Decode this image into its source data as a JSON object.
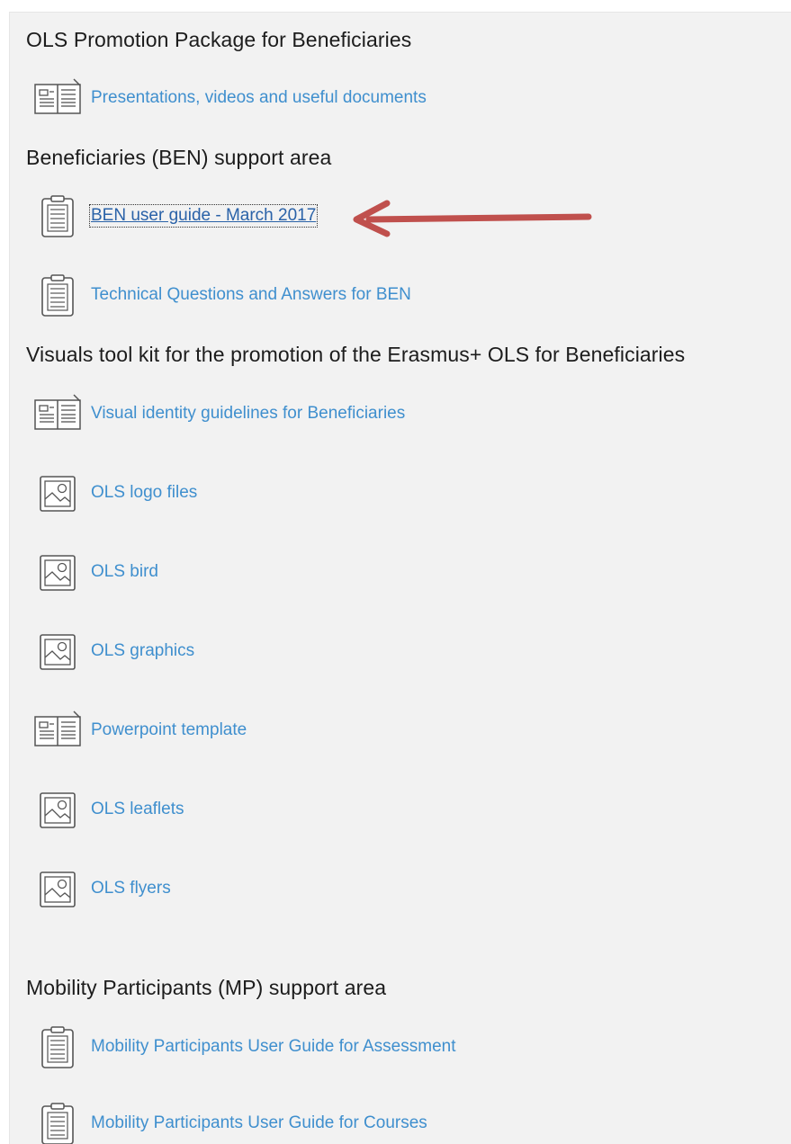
{
  "sections": [
    {
      "heading": "OLS Promotion Package for Beneficiaries",
      "items": [
        {
          "label": "Presentations, videos and useful documents",
          "icon": "book-icon"
        }
      ]
    },
    {
      "heading": "Beneficiaries (BEN) support area",
      "items": [
        {
          "label": "BEN user guide - March 2017",
          "icon": "clipboard-icon",
          "state": "focused"
        },
        {
          "label": "Technical Questions and Answers for BEN",
          "icon": "clipboard-icon"
        }
      ]
    },
    {
      "heading": "Visuals tool kit for the promotion of the Erasmus+ OLS for Beneficiaries",
      "items": [
        {
          "label": "Visual identity guidelines for Beneficiaries",
          "icon": "book-icon"
        },
        {
          "label": "OLS logo files",
          "icon": "image-icon"
        },
        {
          "label": "OLS bird",
          "icon": "image-icon"
        },
        {
          "label": "OLS graphics",
          "icon": "image-icon"
        },
        {
          "label": "Powerpoint template",
          "icon": "book-icon"
        },
        {
          "label": "OLS leaflets",
          "icon": "image-icon"
        },
        {
          "label": "OLS flyers",
          "icon": "image-icon"
        }
      ]
    },
    {
      "heading": "Mobility Participants (MP) support area",
      "items": [
        {
          "label": "Mobility Participants User Guide for Assessment",
          "icon": "clipboard-icon"
        },
        {
          "label": "Mobility Participants User Guide for Courses",
          "icon": "clipboard-icon"
        }
      ]
    }
  ],
  "colors": {
    "link": "#3f8fce",
    "link_focused": "#2a62a8",
    "heading": "#1c1c1c",
    "panel_bg": "#f2f2f2",
    "arrow": "#c0504d"
  }
}
